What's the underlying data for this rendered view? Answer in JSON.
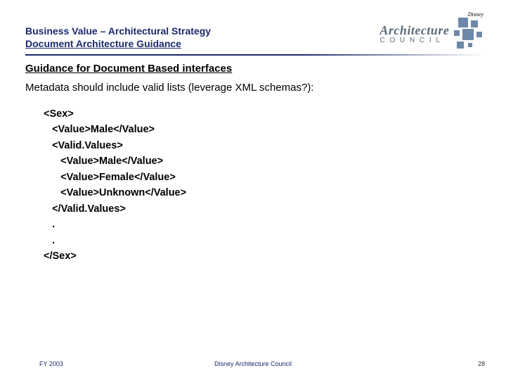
{
  "header": {
    "title_line1": "Business Value – Architectural Strategy",
    "title_line2": "Document Architecture Guidance",
    "logo": {
      "brand_small": "Disney",
      "word1": "Architecture",
      "word2": "C O U N C I L"
    }
  },
  "body": {
    "subheading": "Guidance for Document Based interfaces",
    "lead": "Metadata should include valid lists (leverage XML schemas?):",
    "code": "<Sex>\n   <Value>Male</Value>\n   <Valid.Values>\n      <Value>Male</Value>\n      <Value>Female</Value>\n      <Value>Unknown</Value>\n   </Valid.Values>\n   .\n   .\n</Sex>"
  },
  "footer": {
    "left": "FY 2003",
    "center": "Disney Architecture Council",
    "right": "28"
  }
}
